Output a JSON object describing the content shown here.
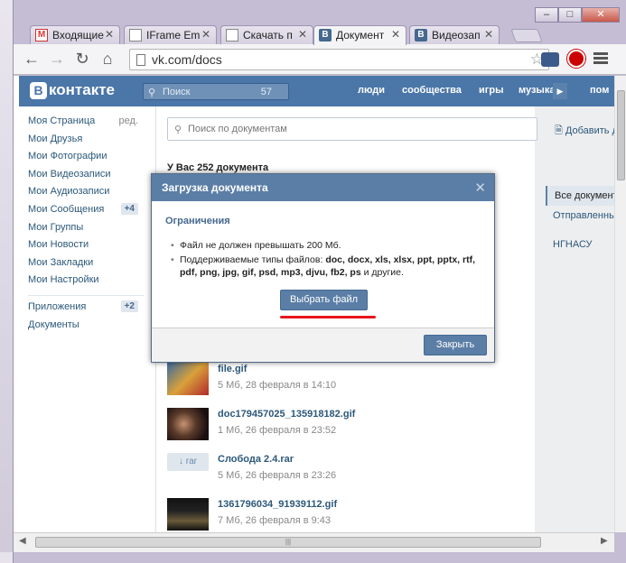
{
  "browser": {
    "tabs": [
      {
        "title": "Входящие",
        "favicon": "gmail-icon"
      },
      {
        "title": "IFrame Em",
        "favicon": "document-icon"
      },
      {
        "title": "Скачать п",
        "favicon": "document-icon"
      },
      {
        "title": "Документ",
        "favicon": "vk-icon"
      },
      {
        "title": "Видеозап",
        "favicon": "vk-icon"
      }
    ],
    "url": "vk.com/docs"
  },
  "vk": {
    "logo_letter": "В",
    "logo_text": "контакте",
    "search_placeholder": "Поиск",
    "search_count": "57",
    "nav": [
      "люди",
      "сообщества",
      "игры",
      "музыка",
      "пом"
    ],
    "left_menu": [
      {
        "label": "Моя Страница",
        "extra": "ред."
      },
      {
        "label": "Мои Друзья"
      },
      {
        "label": "Мои Фотографии"
      },
      {
        "label": "Мои Видеозаписи"
      },
      {
        "label": "Мои Аудиозаписи"
      },
      {
        "label": "Мои Сообщения",
        "badge": "+4"
      },
      {
        "label": "Мои Группы"
      },
      {
        "label": "Мои Новости"
      },
      {
        "label": "Мои Закладки"
      },
      {
        "label": "Мои Настройки"
      }
    ],
    "left_menu_2": [
      {
        "label": "Приложения",
        "badge": "+2"
      },
      {
        "label": "Документы"
      }
    ]
  },
  "docs": {
    "search_placeholder": "Поиск по документам",
    "add_label": "Добавить д",
    "count_label": "У Вас 252 документа",
    "filters": [
      "Все документы",
      "Отправленные",
      "НГНАСУ"
    ],
    "items": [
      {
        "name": "file.gif",
        "meta": "5 Мб, 28 февраля в 14:10",
        "thumb": "gif"
      },
      {
        "name": "doc179457025_135918182.gif",
        "meta": "1 Мб, 26 февраля в 23:52",
        "thumb": "gif"
      },
      {
        "name": "Слобода 2.4.rar",
        "meta": "5 Мб, 26 февраля в 23:26",
        "thumb": "rar",
        "ext_label": "↓ rar"
      },
      {
        "name": "1361796034_91939112.gif",
        "meta": "7 Мб, 26 февраля в 9:43",
        "thumb": "gif"
      }
    ]
  },
  "modal": {
    "title": "Загрузка документа",
    "subtitle": "Ограничения",
    "rule1": "Файл не должен превышать 200 Мб.",
    "rule2_prefix": "Поддерживаемые типы файлов: ",
    "rule2_types": "doc, docx, xls, xlsx, ppt, pptx, rtf, pdf, png, jpg, gif, psd, mp3, djvu, fb2, ps",
    "rule2_suffix": " и другие.",
    "choose_button": "Выбрать файл",
    "close_button": "Закрыть"
  },
  "colors": {
    "vk_blue": "#4a76a8",
    "modal_header": "#5b7ea6",
    "highlight_underline": "#e8161c"
  }
}
